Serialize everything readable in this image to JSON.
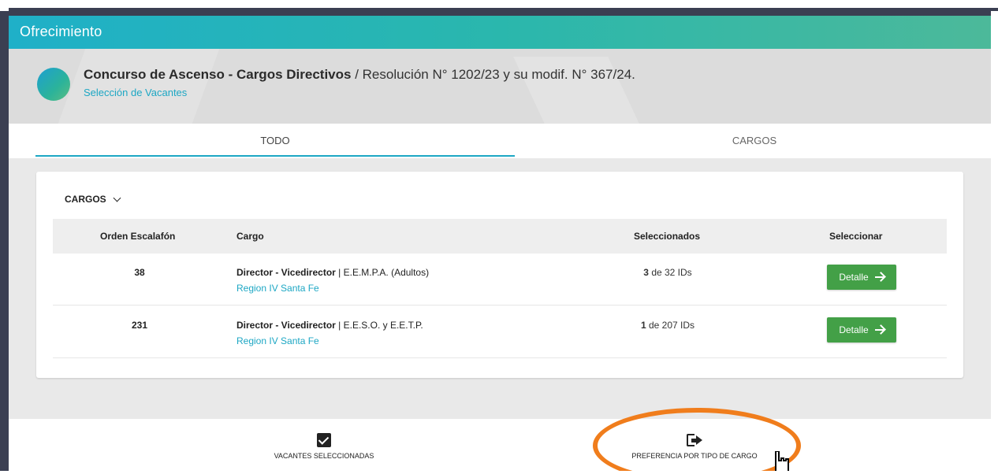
{
  "window": {
    "title": "Ofrecimiento"
  },
  "header": {
    "title_bold": "Concurso de Ascenso - Cargos Directivos",
    "title_rest": " / Resolución N° 1202/23 y su modif. N° 367/24.",
    "subtitle": "Selección de Vacantes"
  },
  "tabs": [
    {
      "label": "TODO",
      "active": true
    },
    {
      "label": "CARGOS",
      "active": false
    }
  ],
  "card": {
    "section_label": "CARGOS",
    "columns": [
      "Orden Escalafón",
      "Cargo",
      "Seleccionados",
      "Seleccionar"
    ],
    "rows": [
      {
        "orden": "38",
        "cargo_bold": "Director - Vicedirector",
        "cargo_rest": " | E.E.M.P.A. (Adultos)",
        "region": "Region IV Santa Fe",
        "sel_count": "3",
        "sel_rest": " de 32 IDs",
        "button": "Detalle"
      },
      {
        "orden": "231",
        "cargo_bold": "Director - Vicedirector",
        "cargo_rest": " | E.E.S.O. y E.E.T.P.",
        "region": "Region IV Santa Fe",
        "sel_count": "1",
        "sel_rest": " de 207 IDs",
        "button": "Detalle"
      }
    ]
  },
  "bottom_nav": {
    "vacantes_label": "VACANTES SELECCIONADAS",
    "vacantes_icon": "checkbox-checked-icon",
    "preferencia_label": "PREFERENCIA POR TIPO DE CARGO",
    "preferencia_icon": "exit-arrow-icon"
  },
  "colors": {
    "accent": "#1da7c4",
    "button_green": "#43a047",
    "highlight_orange": "#f07d1c"
  }
}
